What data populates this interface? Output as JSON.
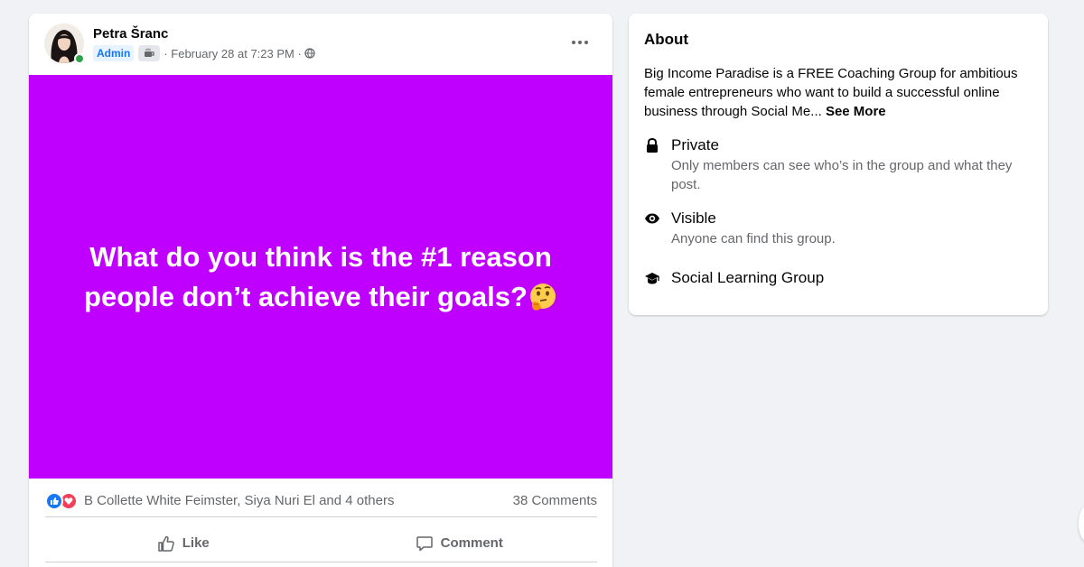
{
  "post": {
    "author_name": "Petra Šranc",
    "admin_label": "Admin",
    "timestamp": "· February 28 at 7:23 PM ·",
    "more_icon": "more-horizontal-icon",
    "image_text_line1": "What do you think is the #1 reason",
    "image_text_line2": "people don’t achieve their goals?",
    "image_bg": "#c000ff",
    "emoji": "thinking-face",
    "reactions_text": "B Collette White Feimster, Siya Nuri El and 4 others",
    "comments_text": "38 Comments",
    "like_label": "Like",
    "comment_label": "Comment"
  },
  "about": {
    "title": "About",
    "description": "Big Income Paradise is a FREE Coaching Group for ambitious female entrepreneurs who want to build a successful online business through Social Me...",
    "see_more": "See More",
    "private_title": "Private",
    "private_desc": "Only members can see who’s in the group and what they post.",
    "visible_title": "Visible",
    "visible_desc": "Anyone can find this group.",
    "learning_title": "Social Learning Group"
  }
}
